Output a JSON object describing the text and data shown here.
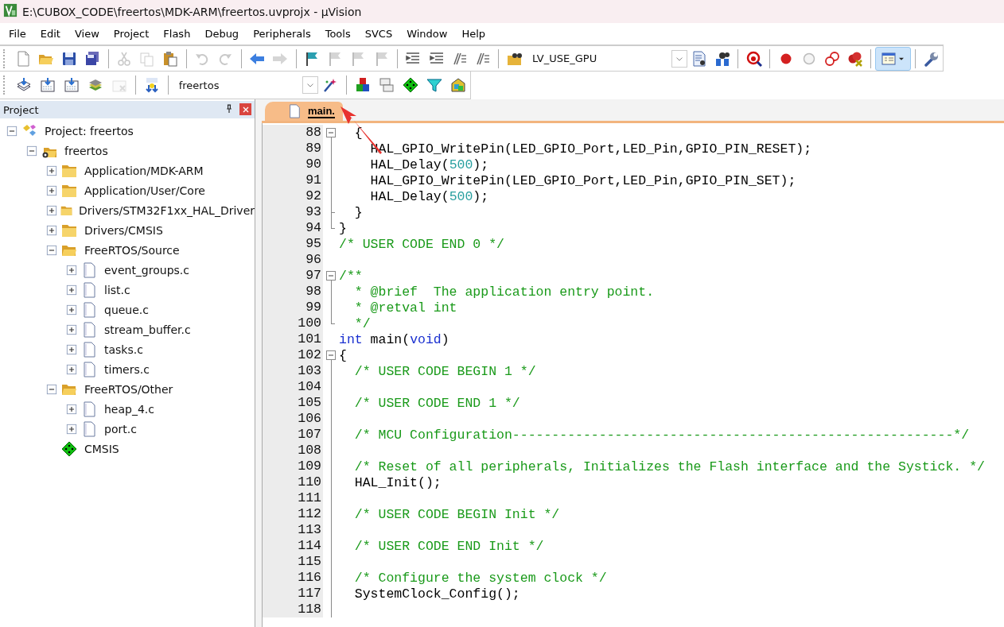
{
  "window": {
    "title": "E:\\CUBOX_CODE\\freertos\\MDK-ARM\\freertos.uvprojx - µVision"
  },
  "menu": [
    "File",
    "Edit",
    "View",
    "Project",
    "Flash",
    "Debug",
    "Peripherals",
    "Tools",
    "SVCS",
    "Window",
    "Help"
  ],
  "toolbar_1": [
    {
      "kind": "new",
      "disabled": false
    },
    {
      "kind": "open",
      "disabled": false
    },
    {
      "kind": "save",
      "disabled": false
    },
    {
      "kind": "saveall",
      "disabled": false
    },
    {
      "kind": "sep"
    },
    {
      "kind": "cut",
      "disabled": true
    },
    {
      "kind": "copy",
      "disabled": true
    },
    {
      "kind": "paste",
      "disabled": false
    },
    {
      "kind": "sep"
    },
    {
      "kind": "undo",
      "disabled": true
    },
    {
      "kind": "redo",
      "disabled": true
    },
    {
      "kind": "sep"
    },
    {
      "kind": "back",
      "disabled": false
    },
    {
      "kind": "forward",
      "disabled": true
    },
    {
      "kind": "sep"
    },
    {
      "kind": "bookmark",
      "disabled": false
    },
    {
      "kind": "bookmark",
      "disabled": true
    },
    {
      "kind": "bookmark",
      "disabled": true
    },
    {
      "kind": "bookmark",
      "disabled": true
    },
    {
      "kind": "sep"
    },
    {
      "kind": "indent",
      "disabled": false
    },
    {
      "kind": "indent",
      "disabled": false
    },
    {
      "kind": "comment",
      "disabled": false
    },
    {
      "kind": "comment",
      "disabled": false
    },
    {
      "kind": "sep"
    },
    {
      "kind": "findfiles",
      "disabled": false
    },
    {
      "kind": "combo",
      "value": "LV_USE_GPU"
    },
    {
      "kind": "find",
      "disabled": false
    },
    {
      "kind": "incfind",
      "disabled": false
    },
    {
      "kind": "sep"
    },
    {
      "kind": "debug",
      "disabled": false
    },
    {
      "kind": "sep"
    },
    {
      "kind": "bp",
      "disabled": false
    },
    {
      "kind": "bpoff",
      "disabled": false
    },
    {
      "kind": "bpall",
      "disabled": false
    },
    {
      "kind": "bpkill",
      "disabled": false
    },
    {
      "kind": "sep"
    },
    {
      "kind": "window",
      "on": true
    },
    {
      "kind": "sep"
    },
    {
      "kind": "wrench",
      "disabled": false
    }
  ],
  "toolbar_2": [
    {
      "kind": "translate",
      "disabled": false
    },
    {
      "kind": "build",
      "disabled": false
    },
    {
      "kind": "build",
      "disabled": false
    },
    {
      "kind": "batch",
      "disabled": false
    },
    {
      "kind": "stop",
      "disabled": true
    },
    {
      "kind": "sep"
    },
    {
      "kind": "load",
      "disabled": false
    },
    {
      "kind": "sep"
    },
    {
      "kind": "combo",
      "value": "freertos"
    },
    {
      "kind": "wand",
      "disabled": false
    },
    {
      "kind": "sep"
    },
    {
      "kind": "blocks",
      "disabled": false
    },
    {
      "kind": "files",
      "disabled": false
    },
    {
      "kind": "diamond",
      "disabled": false
    },
    {
      "kind": "filter",
      "disabled": false
    },
    {
      "kind": "package",
      "disabled": false
    }
  ],
  "project_panel": {
    "title": "Project",
    "tree": [
      {
        "kind": "project",
        "label": "Project: freertos",
        "expanded": true,
        "children": [
          {
            "kind": "target",
            "label": "freertos",
            "expanded": true,
            "children": [
              {
                "kind": "folder",
                "label": "Application/MDK-ARM",
                "expanded": false
              },
              {
                "kind": "folder",
                "label": "Application/User/Core",
                "expanded": false
              },
              {
                "kind": "folder",
                "label": "Drivers/STM32F1xx_HAL_Driver",
                "expanded": false
              },
              {
                "kind": "folder",
                "label": "Drivers/CMSIS",
                "expanded": false
              },
              {
                "kind": "folder",
                "label": "FreeRTOS/Source",
                "expanded": true,
                "children": [
                  {
                    "kind": "file",
                    "label": "event_groups.c",
                    "expanded": false
                  },
                  {
                    "kind": "file",
                    "label": "list.c",
                    "expanded": false
                  },
                  {
                    "kind": "file",
                    "label": "queue.c",
                    "expanded": false
                  },
                  {
                    "kind": "file",
                    "label": "stream_buffer.c",
                    "expanded": false
                  },
                  {
                    "kind": "file",
                    "label": "tasks.c",
                    "expanded": false
                  },
                  {
                    "kind": "file",
                    "label": "timers.c",
                    "expanded": false
                  }
                ]
              },
              {
                "kind": "folder",
                "label": "FreeRTOS/Other",
                "expanded": true,
                "children": [
                  {
                    "kind": "file",
                    "label": "heap_4.c",
                    "expanded": false
                  },
                  {
                    "kind": "file",
                    "label": "port.c",
                    "expanded": false
                  }
                ]
              },
              {
                "kind": "component",
                "label": "CMSIS"
              }
            ]
          }
        ]
      }
    ]
  },
  "editor": {
    "tabs": [
      {
        "label": "main.",
        "selected": true
      }
    ],
    "lines": [
      {
        "number": "88",
        "kind": "start",
        "tokens": [
          {
            "kind": "code",
            "text": "  {"
          }
        ]
      },
      {
        "number": "89",
        "kind": "inside",
        "tokens": [
          {
            "kind": "code",
            "text": "    HAL_GPIO_WritePin(LED_GPIO_Port,LED_Pin,GPIO_PIN_RESET);"
          }
        ]
      },
      {
        "number": "90",
        "kind": "inside",
        "tokens": [
          {
            "kind": "code",
            "text": "    HAL_Delay("
          },
          {
            "kind": "number",
            "text": "500"
          },
          {
            "kind": "code",
            "text": ");"
          }
        ]
      },
      {
        "number": "91",
        "kind": "inside",
        "tokens": [
          {
            "kind": "code",
            "text": "    HAL_GPIO_WritePin(LED_GPIO_Port,LED_Pin,GPIO_PIN_SET);"
          }
        ]
      },
      {
        "number": "92",
        "kind": "inside",
        "tokens": [
          {
            "kind": "code",
            "text": "    HAL_Delay("
          },
          {
            "kind": "number",
            "text": "500"
          },
          {
            "kind": "code",
            "text": ");"
          }
        ]
      },
      {
        "number": "93",
        "kind": "tick",
        "tokens": [
          {
            "kind": "code",
            "text": "  }"
          }
        ]
      },
      {
        "number": "94",
        "kind": "end",
        "tokens": [
          {
            "kind": "code",
            "text": "}"
          }
        ]
      },
      {
        "number": "95",
        "kind": "plain",
        "tokens": [
          {
            "kind": "comment",
            "text": "/* USER CODE END 0 */"
          }
        ]
      },
      {
        "number": "96",
        "kind": "plain"
      },
      {
        "number": "97",
        "kind": "start",
        "tokens": [
          {
            "kind": "comment",
            "text": "/**"
          }
        ]
      },
      {
        "number": "98",
        "kind": "inside",
        "tokens": [
          {
            "kind": "comment",
            "text": "  * @brief  The application entry point."
          }
        ]
      },
      {
        "number": "99",
        "kind": "inside",
        "tokens": [
          {
            "kind": "comment",
            "text": "  * @retval int"
          }
        ]
      },
      {
        "number": "100",
        "kind": "end",
        "tokens": [
          {
            "kind": "comment",
            "text": "  */"
          }
        ]
      },
      {
        "number": "101",
        "kind": "plain",
        "tokens": [
          {
            "kind": "keyword",
            "text": "int"
          },
          {
            "kind": "code",
            "text": " main("
          },
          {
            "kind": "keyword",
            "text": "void"
          },
          {
            "kind": "code",
            "text": ")"
          }
        ]
      },
      {
        "number": "102",
        "kind": "start",
        "tokens": [
          {
            "kind": "code",
            "text": "{"
          }
        ]
      },
      {
        "number": "103",
        "kind": "inside",
        "tokens": [
          {
            "kind": "comment",
            "text": "  /* USER CODE BEGIN 1 */"
          }
        ]
      },
      {
        "number": "104",
        "kind": "inside"
      },
      {
        "number": "105",
        "kind": "inside",
        "tokens": [
          {
            "kind": "comment",
            "text": "  /* USER CODE END 1 */"
          }
        ]
      },
      {
        "number": "106",
        "kind": "inside"
      },
      {
        "number": "107",
        "kind": "inside",
        "tokens": [
          {
            "kind": "comment",
            "text": "  /* MCU Configuration--------------------------------------------------------*/"
          }
        ]
      },
      {
        "number": "108",
        "kind": "inside"
      },
      {
        "number": "109",
        "kind": "inside",
        "tokens": [
          {
            "kind": "comment",
            "text": "  /* Reset of all peripherals, Initializes the Flash interface and the Systick. */"
          }
        ]
      },
      {
        "number": "110",
        "kind": "inside",
        "tokens": [
          {
            "kind": "code",
            "text": "  HAL_Init();"
          }
        ]
      },
      {
        "number": "111",
        "kind": "inside"
      },
      {
        "number": "112",
        "kind": "inside",
        "tokens": [
          {
            "kind": "comment",
            "text": "  /* USER CODE BEGIN Init */"
          }
        ]
      },
      {
        "number": "113",
        "kind": "inside"
      },
      {
        "number": "114",
        "kind": "inside",
        "tokens": [
          {
            "kind": "comment",
            "text": "  /* USER CODE END Init */"
          }
        ]
      },
      {
        "number": "115",
        "kind": "inside"
      },
      {
        "number": "116",
        "kind": "inside",
        "tokens": [
          {
            "kind": "comment",
            "text": "  /* Configure the system clock */"
          }
        ]
      },
      {
        "number": "117",
        "kind": "inside",
        "tokens": [
          {
            "kind": "code",
            "text": "  SystemClock_Config();"
          }
        ]
      },
      {
        "number": "118",
        "kind": "inside"
      }
    ]
  }
}
